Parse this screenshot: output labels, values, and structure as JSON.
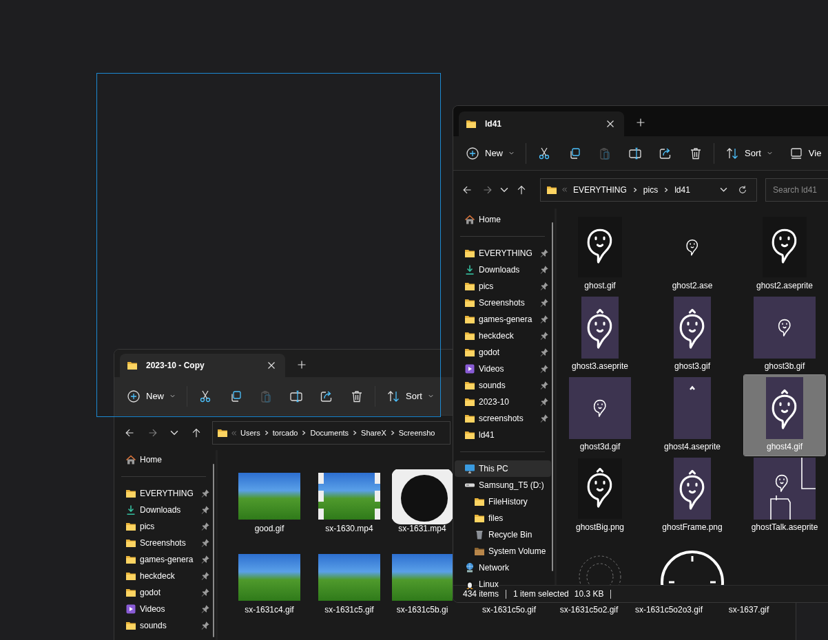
{
  "background_window": {
    "tab": {
      "title": "2023-10 - Copy"
    },
    "toolbar": [
      {
        "kind": "new",
        "label": "New",
        "disabled": false
      },
      {
        "kind": "separator"
      },
      {
        "kind": "cut",
        "disabled": false
      },
      {
        "kind": "copy",
        "disabled": false
      },
      {
        "kind": "paste",
        "disabled": true
      },
      {
        "kind": "rename",
        "disabled": false
      },
      {
        "kind": "share",
        "disabled": false
      },
      {
        "kind": "delete",
        "disabled": false
      },
      {
        "kind": "separator"
      },
      {
        "kind": "sort",
        "label": "Sort",
        "disabled": false
      }
    ],
    "nav": [
      {
        "kind": "back",
        "disabled": false
      },
      {
        "kind": "forward",
        "disabled": true
      },
      {
        "kind": "recent",
        "disabled": false
      },
      {
        "kind": "up",
        "disabled": false
      }
    ],
    "address": {
      "segments": [
        "Users",
        "torcado",
        "Documents",
        "ShareX",
        "Screensho"
      ]
    },
    "sidebar": {
      "top": [
        {
          "label": "Home",
          "kind": "home",
          "selected": false
        }
      ],
      "quick_access": [
        {
          "label": "EVERYTHING",
          "kind": "folder",
          "pinned": true,
          "selected": false
        },
        {
          "label": "Downloads",
          "kind": "download",
          "pinned": true,
          "selected": false
        },
        {
          "label": "pics",
          "kind": "folder",
          "pinned": true,
          "selected": false
        },
        {
          "label": "Screenshots",
          "kind": "folder",
          "pinned": true,
          "selected": false
        },
        {
          "label": "games-genera",
          "kind": "folder",
          "pinned": true,
          "selected": false
        },
        {
          "label": "heckdeck",
          "kind": "folder",
          "pinned": true,
          "selected": false
        },
        {
          "label": "godot",
          "kind": "folder",
          "pinned": true,
          "selected": false
        },
        {
          "label": "Videos",
          "kind": "videos",
          "pinned": true,
          "selected": false
        },
        {
          "label": "sounds",
          "kind": "folder",
          "pinned": true,
          "selected": false
        }
      ]
    },
    "files": {
      "rows": [
        [
          {
            "label": "good.gif",
            "kind": "game",
            "selected": false
          },
          {
            "label": "sx-1630.mp4",
            "kind": "video",
            "selected": false
          },
          {
            "label": "sx-1631.mp4",
            "kind": "ring",
            "selected": false
          }
        ],
        [
          {
            "label": "sx-1631c4.gif",
            "kind": "game",
            "selected": false
          },
          {
            "label": "sx-1631c5.gif",
            "kind": "game",
            "selected": false
          },
          {
            "label": "sx-1631c5b.gi",
            "kind": "game",
            "selected": false
          },
          {
            "label": "sx-1631c5o.gif",
            "kind": "hidden",
            "selected": false
          },
          {
            "label": "sx-1631c5o2.gif",
            "kind": "hidden",
            "selected": false
          },
          {
            "label": "sx-1631c5o2o3.gif",
            "kind": "hidden",
            "selected": false
          },
          {
            "label": "sx-1637.gif",
            "kind": "hidden",
            "selected": false
          }
        ]
      ]
    }
  },
  "foreground_window": {
    "tab": {
      "title": "ld41"
    },
    "toolbar": [
      {
        "kind": "new",
        "label": "New",
        "disabled": false
      },
      {
        "kind": "separator"
      },
      {
        "kind": "cut",
        "disabled": false
      },
      {
        "kind": "copy",
        "disabled": false
      },
      {
        "kind": "paste",
        "disabled": true
      },
      {
        "kind": "rename",
        "disabled": false
      },
      {
        "kind": "share",
        "disabled": false
      },
      {
        "kind": "delete",
        "disabled": false
      },
      {
        "kind": "separator"
      },
      {
        "kind": "sort",
        "label": "Sort",
        "disabled": false
      },
      {
        "kind": "view",
        "label": "Vie",
        "disabled": false
      }
    ],
    "nav": [
      {
        "kind": "back",
        "disabled": false
      },
      {
        "kind": "forward",
        "disabled": true
      },
      {
        "kind": "recent",
        "disabled": false
      },
      {
        "kind": "up",
        "disabled": false
      }
    ],
    "address": {
      "segments": [
        "EVERYTHING",
        "pics",
        "ld41"
      ],
      "buttons": [
        {
          "kind": "history"
        },
        {
          "kind": "refresh"
        }
      ]
    },
    "search": {
      "placeholder": "Search ld41"
    },
    "sidebar": {
      "top": [
        {
          "label": "Home",
          "kind": "home",
          "selected": false
        }
      ],
      "quick_access": [
        {
          "label": "EVERYTHING",
          "kind": "folder",
          "pinned": true,
          "selected": false
        },
        {
          "label": "Downloads",
          "kind": "download",
          "pinned": true,
          "selected": false
        },
        {
          "label": "pics",
          "kind": "folder",
          "pinned": true,
          "selected": false
        },
        {
          "label": "Screenshots",
          "kind": "folder",
          "pinned": true,
          "selected": false
        },
        {
          "label": "games-genera",
          "kind": "folder",
          "pinned": true,
          "selected": false
        },
        {
          "label": "heckdeck",
          "kind": "folder",
          "pinned": true,
          "selected": false
        },
        {
          "label": "godot",
          "kind": "folder",
          "pinned": true,
          "selected": false
        },
        {
          "label": "Videos",
          "kind": "videos",
          "pinned": true,
          "selected": false
        },
        {
          "label": "sounds",
          "kind": "folder",
          "pinned": true,
          "selected": false
        },
        {
          "label": "2023-10",
          "kind": "folder",
          "pinned": true,
          "selected": false
        },
        {
          "label": "screenshots",
          "kind": "folder",
          "pinned": true,
          "selected": false
        },
        {
          "label": "ld41",
          "kind": "folder",
          "pinned": false,
          "selected": false
        }
      ],
      "locations": [
        {
          "label": "This PC",
          "kind": "pc",
          "selected": true
        },
        {
          "label": "Samsung_T5 (D:)",
          "kind": "drive",
          "selected": false,
          "children": [
            {
              "label": "FileHistory",
              "kind": "folder",
              "selected": false
            },
            {
              "label": "files",
              "kind": "folder",
              "selected": false
            },
            {
              "label": "Recycle Bin",
              "kind": "recycle",
              "selected": false
            },
            {
              "label": "System Volume",
              "kind": "sysfolder",
              "selected": false
            }
          ]
        },
        {
          "label": "Network",
          "kind": "network",
          "selected": false
        },
        {
          "label": "Linux",
          "kind": "penguin",
          "selected": false
        }
      ]
    },
    "files": {
      "items": [
        {
          "label": "ghost.gif",
          "kind": "dark",
          "selected": false
        },
        {
          "label": "ghost2.ase",
          "kind": "darksmall",
          "selected": false
        },
        {
          "label": "ghost2.aseprite",
          "kind": "dark",
          "selected": false
        },
        {
          "label": "ghost3.aseprite",
          "kind": "tall",
          "selected": false
        },
        {
          "label": "ghost3.gif",
          "kind": "tall",
          "selected": false
        },
        {
          "label": "ghost3b.gif",
          "kind": "square",
          "selected": false
        },
        {
          "label": "ghost3d.gif",
          "kind": "square",
          "selected": false
        },
        {
          "label": "ghost4.aseprite",
          "kind": "hat",
          "selected": false
        },
        {
          "label": "ghost4.gif",
          "kind": "tall",
          "selected": true
        },
        {
          "label": "ghostBig.png",
          "kind": "darkhat",
          "selected": false
        },
        {
          "label": "ghostFrame.png",
          "kind": "tall",
          "selected": false
        },
        {
          "label": "ghostTalk.aseprite",
          "kind": "talk",
          "selected": false
        },
        {
          "kind": "rings",
          "selected": false
        },
        {
          "kind": "dial",
          "selected": false
        }
      ]
    },
    "status_bar": {
      "item_count": "434 items",
      "selection": "1 item selected",
      "size": "10.3 KB"
    }
  }
}
